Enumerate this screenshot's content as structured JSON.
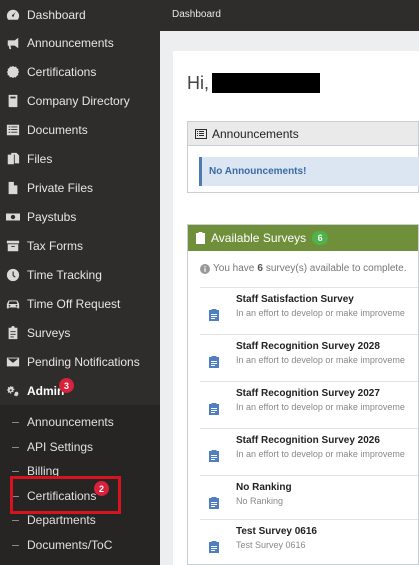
{
  "sidebar": {
    "items": [
      {
        "label": "Dashboard",
        "icon": "dashboard-icon"
      },
      {
        "label": "Announcements",
        "icon": "bullhorn-icon"
      },
      {
        "label": "Certifications",
        "icon": "certificate-icon"
      },
      {
        "label": "Company Directory",
        "icon": "book-icon"
      },
      {
        "label": "Documents",
        "icon": "list-icon"
      },
      {
        "label": "Files",
        "icon": "files-icon"
      },
      {
        "label": "Private Files",
        "icon": "file-icon"
      },
      {
        "label": "Paystubs",
        "icon": "money-icon"
      },
      {
        "label": "Tax Forms",
        "icon": "archive-icon"
      },
      {
        "label": "Time Tracking",
        "icon": "clock-icon"
      },
      {
        "label": "Time Off Request",
        "icon": "car-icon"
      },
      {
        "label": "Surveys",
        "icon": "clipboard-icon"
      },
      {
        "label": "Pending Notifications",
        "icon": "envelope-icon"
      }
    ],
    "admin": {
      "label": "Admin",
      "icon": "cogs-icon",
      "badge": "3"
    },
    "admin_submenu": [
      {
        "label": "Announcements"
      },
      {
        "label": "API Settings"
      },
      {
        "label": "Billing"
      },
      {
        "label": "Certifications",
        "badge": "2"
      },
      {
        "label": "Departments"
      },
      {
        "label": "Documents/ToC"
      }
    ]
  },
  "topbar": {
    "title": "Dashboard"
  },
  "main": {
    "greeting": "Hi,",
    "announcements": {
      "title": "Announcements",
      "empty_text": "No Announcements!"
    },
    "surveys": {
      "title": "Available Surveys",
      "count": "6",
      "info_prefix": "You have",
      "info_count": "6",
      "info_suffix": "survey(s) available to complete.",
      "items": [
        {
          "name": "Staff Satisfaction Survey",
          "desc": "In an effort to develop or make improveme"
        },
        {
          "name": "Staff Recognition Survey 2028",
          "desc": "In an effort to develop or make improveme"
        },
        {
          "name": "Staff Recognition Survey 2027",
          "desc": "In an effort to develop or make improveme"
        },
        {
          "name": "Staff Recognition Survey 2026",
          "desc": "In an effort to develop or make improveme"
        },
        {
          "name": "No Ranking",
          "desc": "No Ranking"
        },
        {
          "name": "Test Survey 0616",
          "desc": "Test Survey 0616"
        }
      ]
    }
  },
  "colors": {
    "sidebar_bg": "#2f2d2b",
    "surveys_header": "#6f8f3a",
    "badge_red": "#d9213b",
    "badge_green": "#4fb34a",
    "highlight_outline": "#d7131f"
  }
}
